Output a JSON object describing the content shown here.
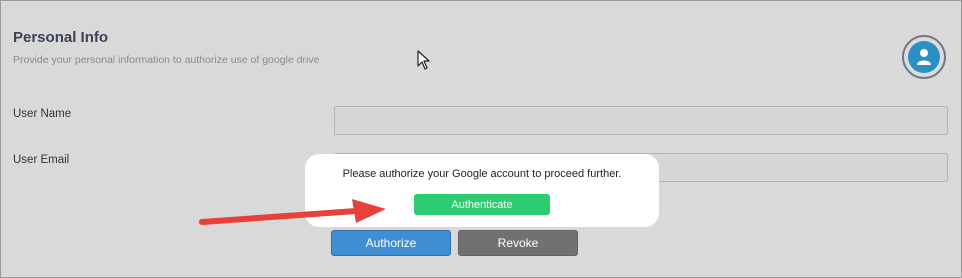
{
  "header": {
    "title": "Personal Info",
    "subtitle": "Provide your personal information to authorize use of google drive",
    "avatar_icon": "user-icon"
  },
  "form": {
    "username_label": "User Name",
    "username_value": "",
    "email_label": "User Email",
    "email_value": ""
  },
  "actions": {
    "authorize_label": "Authorize",
    "revoke_label": "Revoke"
  },
  "popup": {
    "message": "Please authorize your Google account to proceed further.",
    "authenticate_label": "Authenticate"
  },
  "annotation": {
    "arrow_icon": "arrow-right-icon",
    "cursor_icon": "mouse-cursor-icon"
  },
  "colors": {
    "panel_bg": "#d9d9d9",
    "title": "#3b4256",
    "authorize_bg": "#3f8ed3",
    "revoke_bg": "#717171",
    "authenticate_bg": "#2ecc71",
    "avatar_accent": "#2c90c5",
    "arrow": "#e8403a"
  }
}
